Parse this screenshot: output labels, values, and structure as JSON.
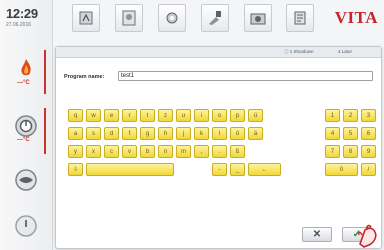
{
  "clock": {
    "time": "12:29",
    "date": "27.06.2016"
  },
  "brand": "VITA",
  "rail": {
    "temp_unit_1": "—°C",
    "temp_unit_2": "—°C"
  },
  "dialog": {
    "tabs": [
      "ⓘ 1 Shutdown",
      "4 Lator"
    ],
    "program_name_label": "Program name:",
    "program_name_value": "test1"
  },
  "keyboard": {
    "row1": [
      "q",
      "w",
      "e",
      "r",
      "t",
      "z",
      "u",
      "i",
      "o",
      "p",
      "ü"
    ],
    "row2": [
      "a",
      "s",
      "d",
      "f",
      "g",
      "h",
      "j",
      "k",
      "l",
      "ö",
      "ä"
    ],
    "row3": [
      "y",
      "x",
      "c",
      "v",
      "b",
      "n",
      "m",
      ",",
      ".",
      "ß"
    ],
    "row4_shift": "⇩",
    "row4_small": [
      "-",
      "_"
    ],
    "row4_back": "←",
    "num_rows": [
      [
        "1",
        "2",
        "3"
      ],
      [
        "4",
        "5",
        "6"
      ],
      [
        "7",
        "8",
        "9"
      ]
    ],
    "num_row4": [
      "0",
      "/"
    ]
  },
  "actions": {
    "cancel_icon": "close-icon",
    "confirm_icon": "check-icon"
  },
  "colors": {
    "accent_red": "#c3262a",
    "key_yellow": "#f5dc4a"
  }
}
